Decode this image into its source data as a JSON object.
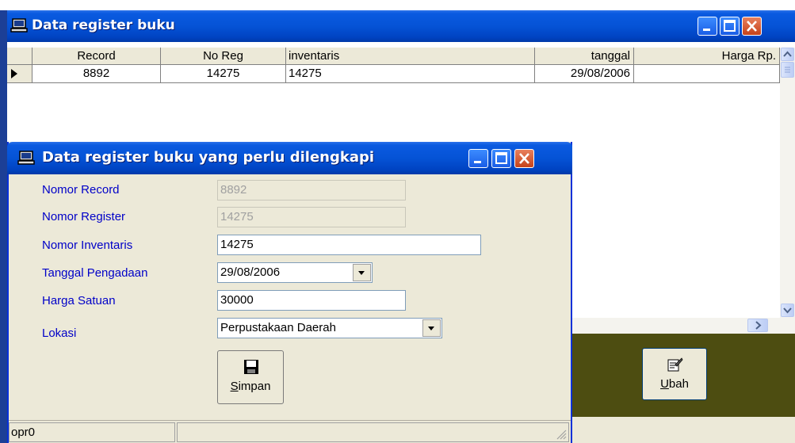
{
  "main_window": {
    "title": "Data register buku",
    "columns": [
      "Record",
      "No Reg",
      "inventaris",
      "tanggal",
      "Harga Rp."
    ],
    "rows": [
      {
        "record": "8892",
        "no_reg": "14275",
        "inventaris": "14275",
        "tanggal": "29/08/2006",
        "harga": ""
      }
    ],
    "ubah_button": "Ubah"
  },
  "dialog": {
    "title": "Data register buku yang perlu dilengkapi",
    "fields": {
      "nomor_record": {
        "label": "Nomor Record",
        "value": "8892"
      },
      "nomor_register": {
        "label": "Nomor Register",
        "value": "14275"
      },
      "nomor_inventaris": {
        "label": "Nomor Inventaris",
        "value": "14275"
      },
      "tanggal_pengadaan": {
        "label": "Tanggal Pengadaan",
        "value": "29/08/2006"
      },
      "harga_satuan": {
        "label": "Harga Satuan",
        "value": "30000"
      },
      "lokasi": {
        "label": "Lokasi",
        "value": "Perpustakaan Daerah"
      }
    },
    "simpan_button": "Simpan",
    "status_user": "opr0"
  },
  "colors": {
    "titlebar": "#0553d6",
    "label_text": "#0000c8",
    "button_panel": "#4d4d11",
    "window_face": "#ece9d8"
  },
  "icons": [
    "computer-icon",
    "minimize-icon",
    "maximize-icon",
    "close-icon",
    "floppy-disk-icon",
    "edit-icon",
    "scroll-up-icon",
    "scroll-down-icon",
    "scroll-right-icon",
    "resize-grip-icon"
  ]
}
